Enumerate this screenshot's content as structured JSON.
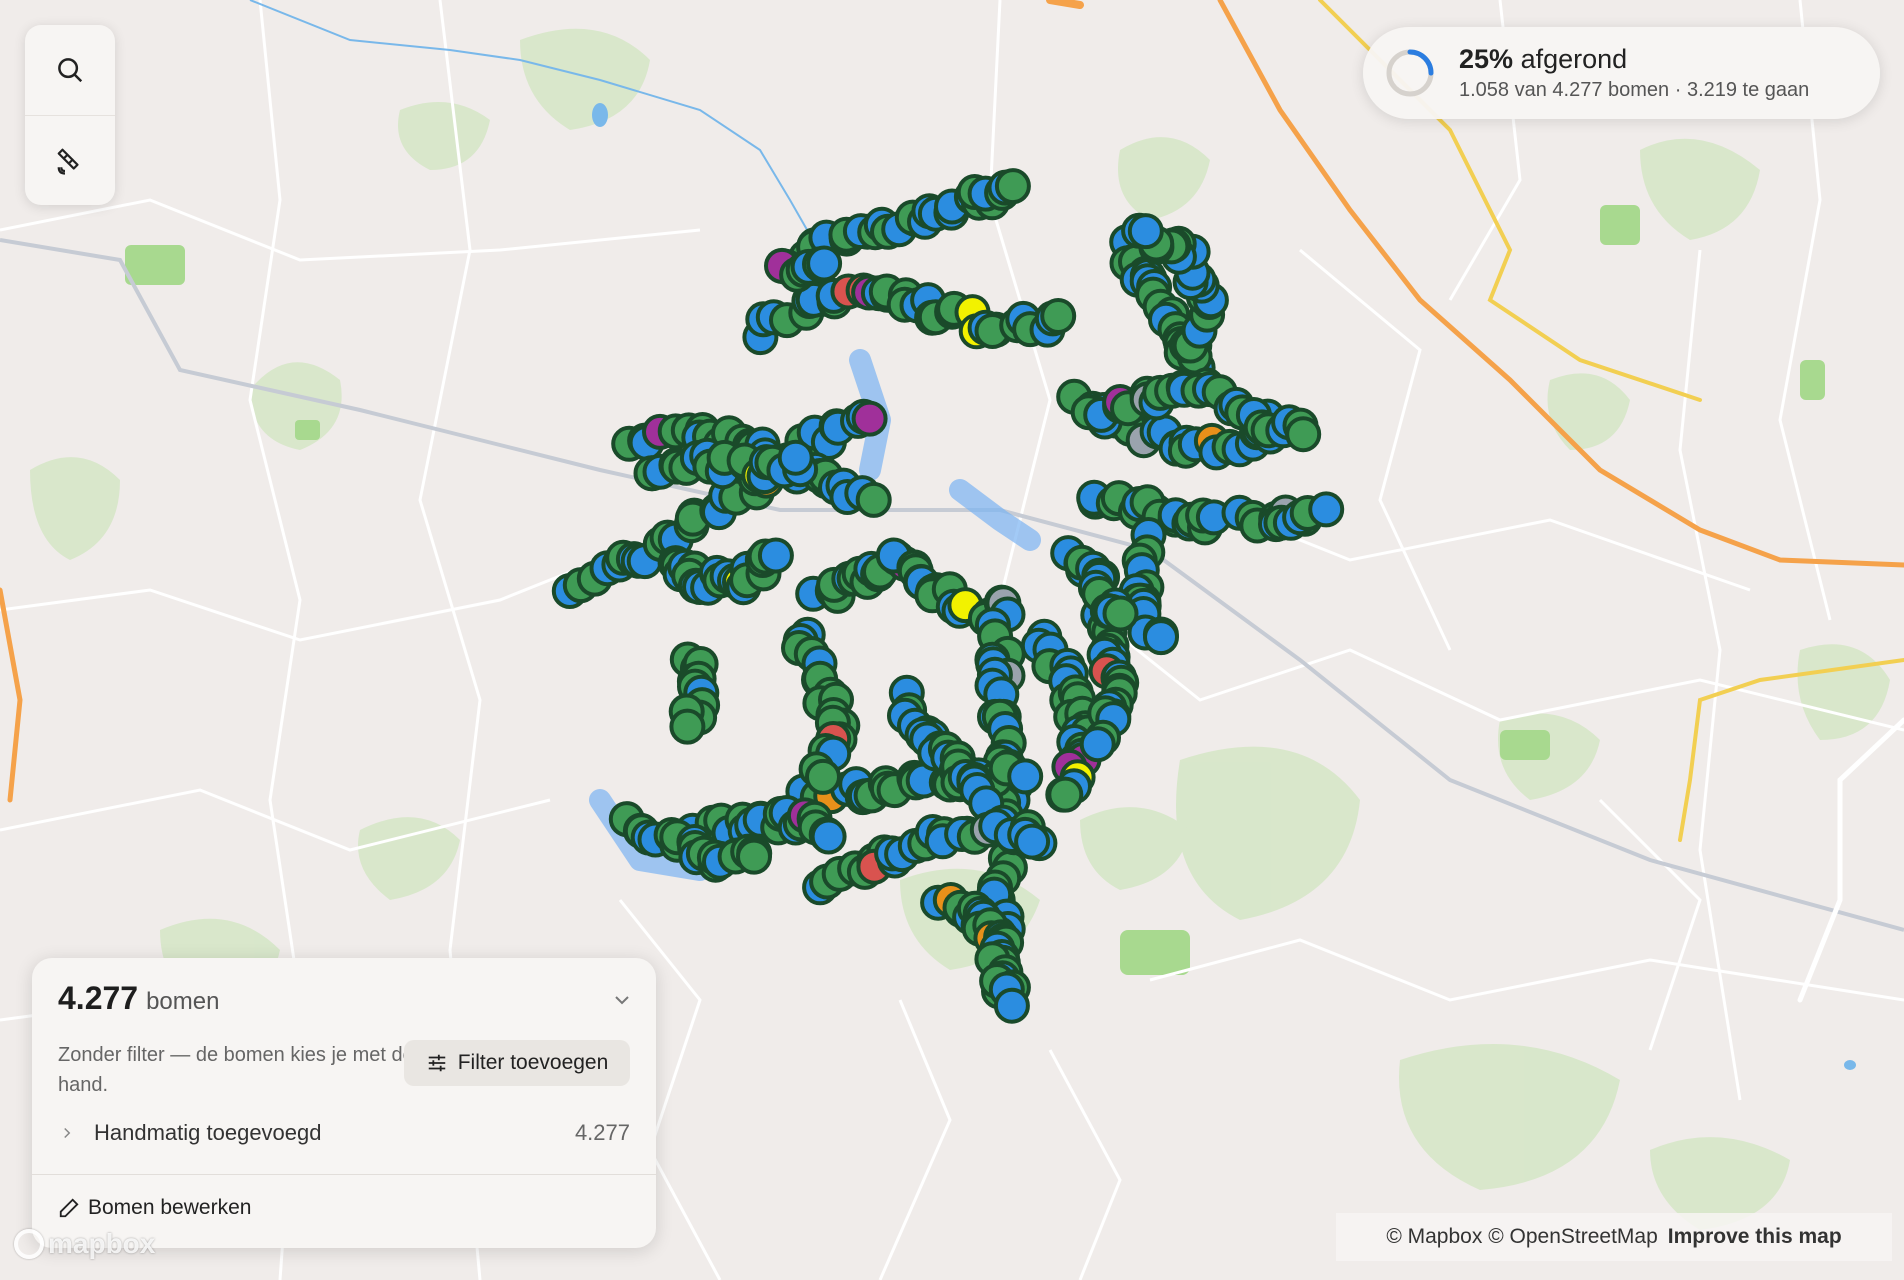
{
  "map": {
    "basemap": "light-streets",
    "colors": {
      "land": "#f0ecea",
      "park": "#cfe3c0",
      "road_minor": "#ffffff",
      "road_major": "#f5a24a",
      "road_secondary": "#f2cf52",
      "rail": "#c9cdd6",
      "water": "#79b8ea",
      "tree_blue": "#2b8de0",
      "tree_green": "#3f9b55",
      "tree_outline": "#1a4a2a",
      "tree_yellow": "#f2f200",
      "tree_orange": "#e8901a",
      "tree_red": "#d9534f",
      "tree_purple": "#a0309a",
      "tree_gray": "#9aa3ad",
      "route_highlight": "#7ab4f2"
    }
  },
  "toolbar": {
    "search_icon": "search-icon",
    "satellite_icon": "satellite-icon"
  },
  "progress": {
    "percent_value": 0.25,
    "percent_label": "25%",
    "status": "afgerond",
    "detail": "1.058 van 4.277 bomen · 3.219 te gaan"
  },
  "summary": {
    "count": "4.277",
    "unit": "bomen",
    "description": "Zonder filter — de bomen kies je met de hand.",
    "filter_button": "Filter toevoegen",
    "manual_label": "Handmatig toegevoegd",
    "manual_count": "4.277",
    "edit_label": "Bomen bewerken"
  },
  "attribution": {
    "mapbox": "© Mapbox",
    "osm": "© OpenStreetMap",
    "improve": "Improve this map"
  },
  "logo": {
    "text": "mapbox"
  }
}
